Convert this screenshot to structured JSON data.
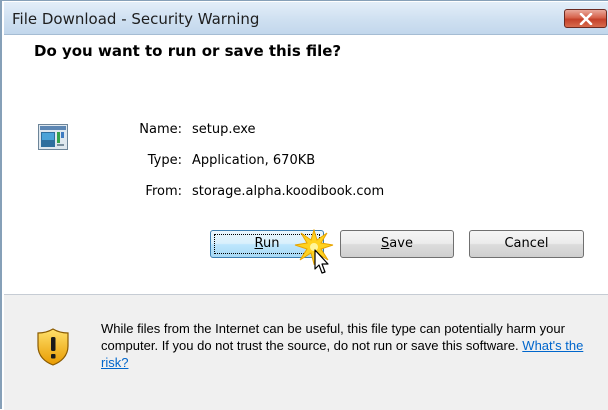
{
  "window": {
    "title": "File Download - Security Warning",
    "close_label": "Close"
  },
  "dialog": {
    "question": "Do you want to run or save this file?",
    "file": {
      "name_label": "Name:",
      "name_value": "setup.exe",
      "type_label": "Type:",
      "type_value": "Application, 670KB",
      "from_label": "From:",
      "from_value": "storage.alpha.koodibook.com"
    },
    "buttons": {
      "run_prefix": "",
      "run_access": "R",
      "run_rest": "un",
      "save_access": "S",
      "save_rest": "ave",
      "cancel": "Cancel"
    },
    "warning": {
      "text": "While files from the Internet can be useful, this file type can potentially harm your computer. If you do not trust the source, do not run or save this software.",
      "link": "What's the risk?"
    }
  },
  "colors": {
    "link": "#0066cc",
    "footer_bg": "#f0f0f0",
    "close_button": "#c4412a",
    "default_button_border": "#3c7fb1"
  },
  "icons": {
    "file": "application-window-icon",
    "shield": "security-shield-icon",
    "close": "close-x-icon",
    "cursor": "mouse-pointer-icon",
    "highlight": "click-sparkle-icon"
  }
}
